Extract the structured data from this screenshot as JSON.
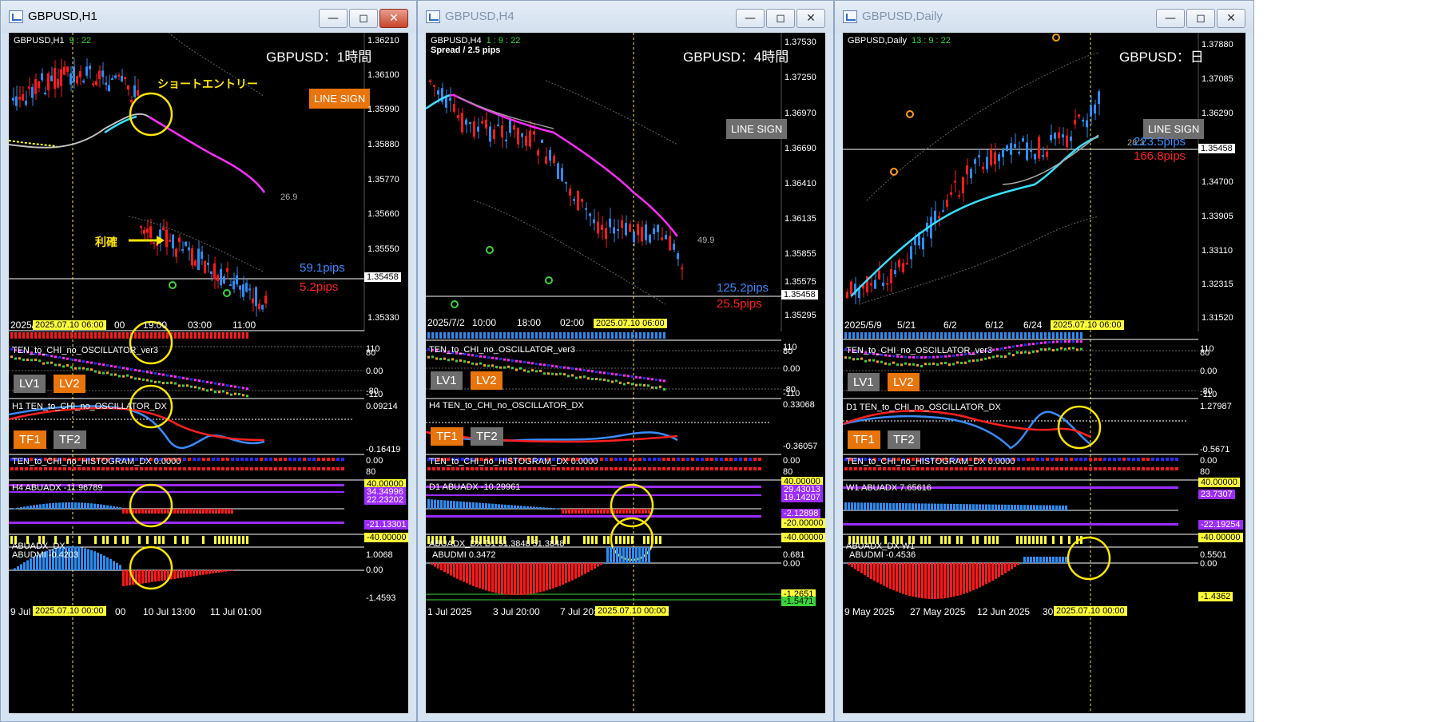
{
  "windows": [
    {
      "title": "GBPUSD,H1",
      "symbol_header": "GBPUSD,H1",
      "timer": "9 : 22",
      "big_label": "GBPUSD：1時間",
      "line_sign": "LINE SIGN",
      "line_sign_color": "#e8740c",
      "price_axis": [
        "1.36210",
        "1.36100",
        "1.35990",
        "1.35880",
        "1.35770",
        "1.35660",
        "1.35550",
        "1.35440",
        "1.35330"
      ],
      "current_price": "1.35458",
      "pips_blue": "59.1pips",
      "pips_red": "5.2pips",
      "adx_value_label": "26.9",
      "time_labels": [
        "2025/",
        "00",
        "19:00",
        "03:00",
        "11:00"
      ],
      "cursor_date": "2025.07.10 06:00",
      "annotations": {
        "short_entry": "ショートエントリー",
        "take_profit": "利確"
      },
      "osc_title": "TEN_to_CHI_no_OSCILLATOR_ver3",
      "osc_axis": [
        "110",
        "80",
        "0.00",
        "-80",
        "-110"
      ],
      "lv1": "LV1",
      "lv2": "LV2",
      "dx_title": "H1 TEN_to_CHI_no_OSCILLATOR_DX",
      "dx_axis": [
        "0.09214",
        "-0.16419"
      ],
      "tf1": "TF1",
      "tf2": "TF2",
      "hist_title": "TEN_to_CHI_no_HISTOGRAM_DX 0.0000",
      "hist_axis": [
        "0.00",
        "80"
      ],
      "abuadx_title": "H4 ABUADX -11.96789",
      "abuadx_axis": [
        "40.00000",
        "34.34996",
        "22.23202",
        "-21.13301",
        "-40.00000"
      ],
      "abuadx_dx_title": "ABUADX_DX",
      "abudmi_title": "ABUDMI -0.4203",
      "abudmi_axis": [
        "1.0068",
        "0.00",
        "-1.4593"
      ],
      "bottom_dates": [
        "9 Jul 2",
        "00",
        "10 Jul 13:00",
        "11 Jul 01:00"
      ],
      "bottom_cursor": "2025.07.10 00:00"
    },
    {
      "title": "GBPUSD,H4",
      "symbol_header": "GBPUSD,H4",
      "timer": "1 : 9 : 22",
      "spread": "Spread / 2.5 pips",
      "big_label": "GBPUSD：4時間",
      "line_sign": "LINE SIGN",
      "line_sign_color": "#6e6e6e",
      "price_axis": [
        "1.37530",
        "1.37250",
        "1.36970",
        "1.36690",
        "1.36410",
        "1.36135",
        "1.35855",
        "1.35575",
        "1.35295"
      ],
      "current_price": "1.35458",
      "pips_blue": "125.2pips",
      "pips_red": "25.5pips",
      "adx_value_label": "49.9",
      "time_labels": [
        "2025/7/2",
        "10:00",
        "18:00",
        "02:00"
      ],
      "cursor_date": "2025.07.10 06:00",
      "osc_title": "TEN_to_CHI_no_OSCILLATOR_ver3",
      "osc_axis": [
        "110",
        "80",
        "0.00",
        "-80",
        "-110"
      ],
      "lv1": "LV1",
      "lv2": "LV2",
      "dx_title": "H4 TEN_to_CHI_no_OSCILLATOR_DX",
      "dx_axis": [
        "0.33068",
        "-0.36057"
      ],
      "tf1": "TF1",
      "tf2": "TF2",
      "hist_title": "TEN_to_CHI_no_HISTOGRAM_DX 0.0000",
      "hist_axis": [
        "0.00",
        "80"
      ],
      "abuadx_title": "D1 ABUADX -10.29961",
      "abuadx_axis": [
        "40.00000",
        "29.43013",
        "19.14207",
        "-2.12898",
        "-20.00000",
        "-40.00000"
      ],
      "abuadx_dx_title": "ABUADX_DX D1 51.3848 51.3848",
      "abudmi_title": "ABUDMI 0.3472",
      "abudmi_axis": [
        "0.681",
        "0.00",
        "-1.2651",
        "-1.5471"
      ],
      "bottom_dates": [
        "1 Jul 2025",
        "3 Jul 20:00",
        "7 Jul 20:"
      ],
      "bottom_cursor": "2025.07.10 00:00"
    },
    {
      "title": "GBPUSD,Daily",
      "symbol_header": "GBPUSD,Daily",
      "timer": "13 : 9 : 22",
      "big_label": "GBPUSD：日",
      "line_sign": "LINE SIGN",
      "line_sign_color": "#6e6e6e",
      "price_axis": [
        "1.37880",
        "1.37085",
        "1.36290",
        "1.35458",
        "1.34700",
        "1.33905",
        "1.33110",
        "1.32315",
        "1.31520"
      ],
      "current_price": "1.35458",
      "pips_blue": "223.5pips",
      "pips_red": "166.8pips",
      "adx_value_label": "28.3",
      "time_labels": [
        "2025/5/9",
        "5/21",
        "6/2",
        "6/12",
        "6/24"
      ],
      "cursor_date": "2025.07.10 06:00",
      "osc_title": "TEN_to_CHI_no_OSCILLATOR_ver3",
      "osc_axis": [
        "110",
        "80",
        "0.00",
        "-80",
        "-110"
      ],
      "lv1": "LV1",
      "lv2": "LV2",
      "dx_title": "D1 TEN_to_CHI_no_OSCILLATOR_DX",
      "dx_axis": [
        "1.27987",
        "-0.5671"
      ],
      "tf1": "TF1",
      "tf2": "TF2",
      "hist_title": "TEN_to_CHI_no_HISTOGRAM_DX 0.0000",
      "hist_axis": [
        "0.00",
        "80"
      ],
      "abuadx_title": "W1 ABUADX 7.65616",
      "abuadx_axis": [
        "40.00000",
        "23.7307",
        "-22.19254",
        "-40.00000"
      ],
      "abuadx_dx_title": "ABUADX_DX W1",
      "abudmi_title": "ABUDMI -0.4536",
      "abudmi_axis": [
        "0.5501",
        "0.00",
        "-1.4362"
      ],
      "bottom_dates": [
        "9 May 2025",
        "27 May 2025",
        "12 Jun 2025",
        "30"
      ],
      "bottom_cursor": "2025.07.10 00:00"
    }
  ]
}
